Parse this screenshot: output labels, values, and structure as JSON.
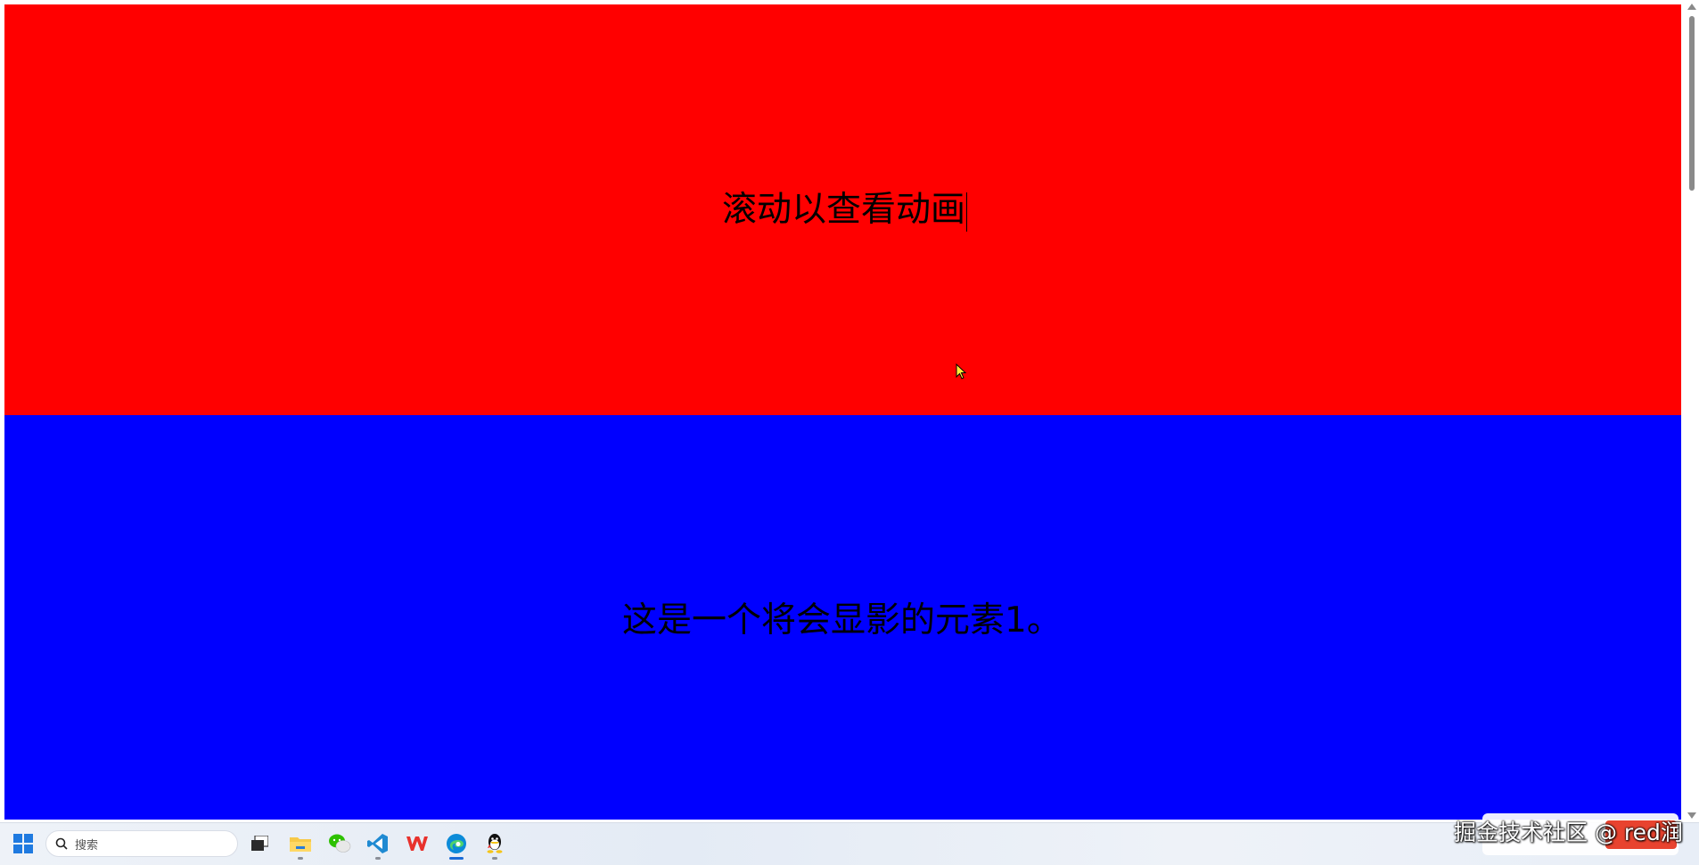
{
  "page": {
    "sections": [
      {
        "text": "滚动以查看动画",
        "color": "#ff0000"
      },
      {
        "text": "这是一个将会显影的元素1。",
        "color": "#0000ff"
      }
    ]
  },
  "taskbar": {
    "search_label": "搜索",
    "apps": [
      {
        "name": "windows-start",
        "active": false
      },
      {
        "name": "task-view",
        "active": false
      },
      {
        "name": "file-explorer",
        "active": false
      },
      {
        "name": "wechat",
        "active": false
      },
      {
        "name": "vscode",
        "active": false
      },
      {
        "name": "wps",
        "active": false
      },
      {
        "name": "edge",
        "active": true
      },
      {
        "name": "qq",
        "active": false
      }
    ]
  },
  "watermark": {
    "text": "掘金技术社区 @ red润"
  }
}
